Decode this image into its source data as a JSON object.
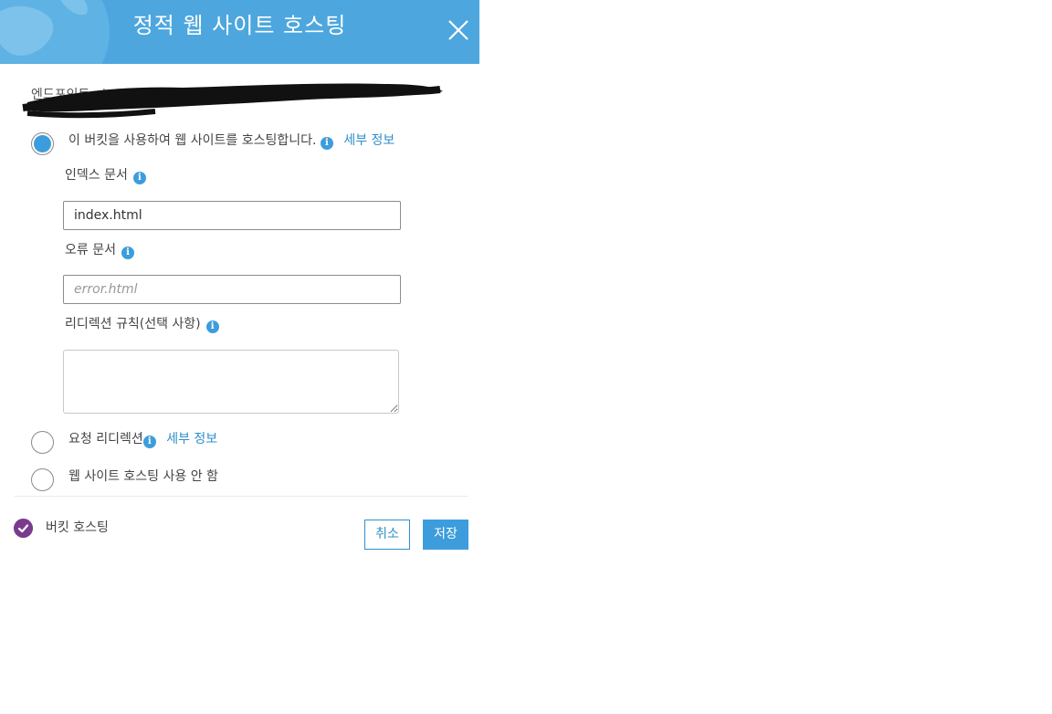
{
  "dialog": {
    "title": "정적 웹 사이트 호스팅"
  },
  "endpoint": {
    "label": "엔드포인트 : ",
    "link_text": "ht"
  },
  "options": [
    {
      "label": "이 버킷을 사용하여 웹 사이트를 호스팅합니다.",
      "more": "세부 정보",
      "selected": true
    },
    {
      "label": "요청 리디렉션",
      "more": "세부 정보",
      "selected": false
    },
    {
      "label": "웹 사이트 호스팅 사용 안 함",
      "selected": false
    }
  ],
  "fields": {
    "index_label": "인덱스 문서",
    "index_value": "index.html",
    "error_label": "오류 문서",
    "error_placeholder": "error.html",
    "redirect_label": "리디렉션 규칙(선택 사항)",
    "redirect_value": ""
  },
  "footer": {
    "status_label": "버킷 호스팅",
    "cancel_label": "취소",
    "save_label": "저장"
  },
  "colors": {
    "header": "#4da7de",
    "accent": "#3d9ddc",
    "link": "#2f8fcb",
    "check": "#7a3b8f"
  },
  "icons": {
    "close": "close-icon",
    "info": "info-icon",
    "check": "check-icon",
    "globe": "globe-icon"
  }
}
